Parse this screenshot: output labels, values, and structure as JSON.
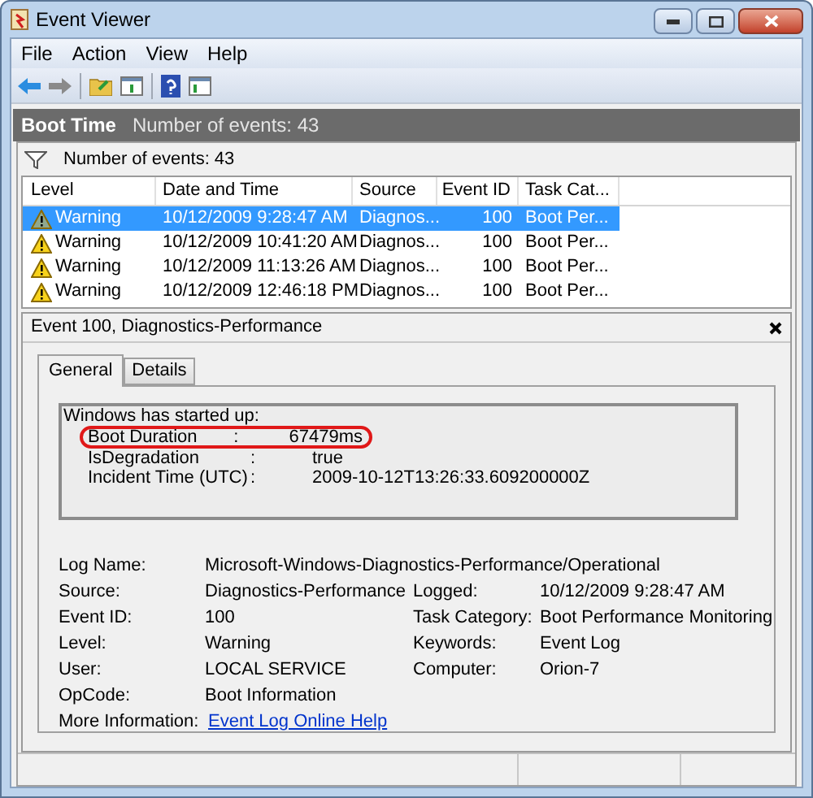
{
  "window": {
    "title": "Event Viewer"
  },
  "menu": [
    "File",
    "Action",
    "View",
    "Help"
  ],
  "header": {
    "title": "Boot Time",
    "count": "Number of events: 43"
  },
  "filter": {
    "text": "Number of events: 43"
  },
  "table": {
    "columns": [
      "Level",
      "Date and Time",
      "Source",
      "Event ID",
      "Task Cat..."
    ],
    "rows": [
      {
        "level": "Warning",
        "date": "10/12/2009 9:28:47 AM",
        "source": "Diagnos...",
        "event_id": "100",
        "task_category": "Boot Per...",
        "selected": true
      },
      {
        "level": "Warning",
        "date": "10/12/2009 10:41:20 AM",
        "source": "Diagnos...",
        "event_id": "100",
        "task_category": "Boot Per...",
        "selected": false
      },
      {
        "level": "Warning",
        "date": "10/12/2009 11:13:26 AM",
        "source": "Diagnos...",
        "event_id": "100",
        "task_category": "Boot Per...",
        "selected": false
      },
      {
        "level": "Warning",
        "date": "10/12/2009 12:46:18 PM",
        "source": "Diagnos...",
        "event_id": "100",
        "task_category": "Boot Per...",
        "selected": false
      }
    ]
  },
  "details": {
    "title": "Event 100, Diagnostics-Performance",
    "tabs": [
      {
        "label": "General",
        "selected": true
      },
      {
        "label": "Details",
        "selected": false
      }
    ],
    "message": {
      "heading": "Windows has started up:",
      "lines": [
        {
          "key": "Boot Duration",
          "sep": ":",
          "value": "67479ms",
          "circled": true
        },
        {
          "key": "IsDegradation",
          "sep": ":",
          "value": "true",
          "circled": false
        },
        {
          "key": "Incident Time (UTC)",
          "sep": ":",
          "value": "2009-10-12T13:26:33.609200000Z",
          "circled": false
        }
      ]
    },
    "fields": [
      {
        "label": "Log Name:",
        "value": "Microsoft-Windows-Diagnostics-Performance/Operational"
      },
      {
        "label": "Source:",
        "value": "Diagnostics-Performance",
        "label2": "Logged:",
        "value2": "10/12/2009 9:28:47 AM"
      },
      {
        "label": "Event ID:",
        "value": "100",
        "label2": "Task Category:",
        "value2": "Boot Performance Monitoring"
      },
      {
        "label": "Level:",
        "value": "Warning",
        "label2": "Keywords:",
        "value2": "Event Log"
      },
      {
        "label": "User:",
        "value": "LOCAL SERVICE",
        "label2": "Computer:",
        "value2": "Orion-7"
      },
      {
        "label": "OpCode:",
        "value": "Boot Information"
      },
      {
        "label": "More Information:",
        "value": "Event Log Online Help",
        "kind": "link"
      }
    ]
  }
}
